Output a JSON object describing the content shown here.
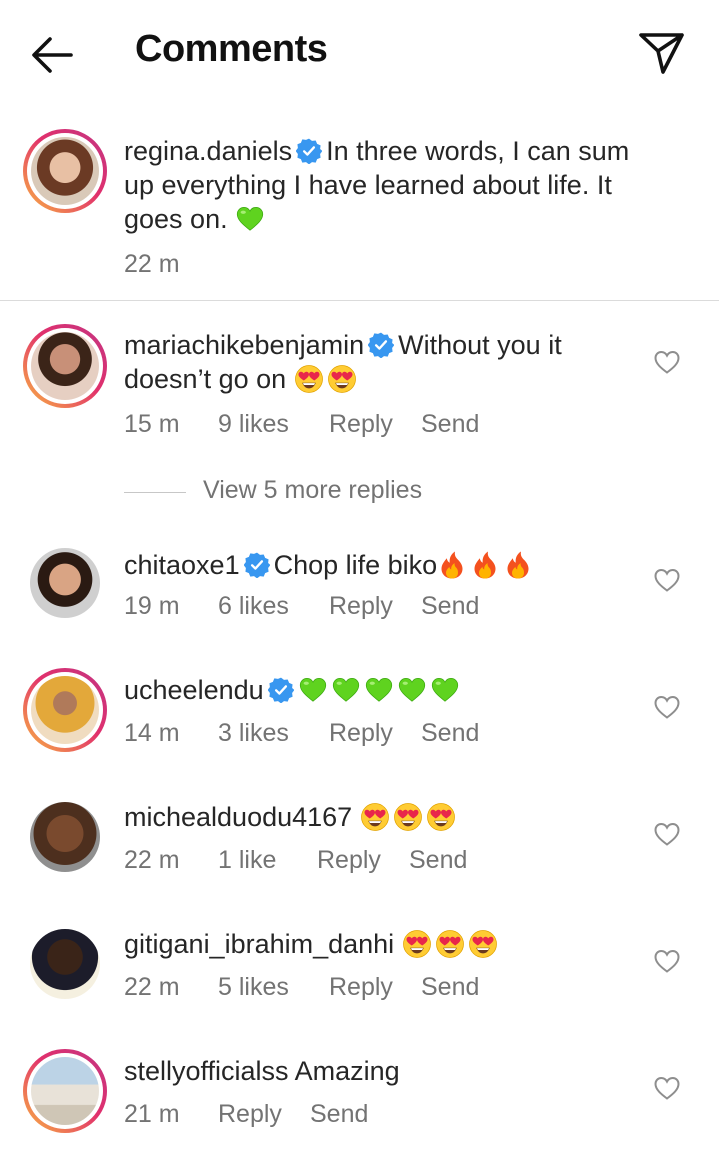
{
  "header": {
    "title": "Comments",
    "back_icon": "arrow-left-icon",
    "send_icon": "paper-plane-icon"
  },
  "caption": {
    "username": "regina.daniels",
    "verified": true,
    "text": "In three words, I can sum up everything I have learned about life. It goes on.",
    "emoji": "green-heart",
    "time": "22 m"
  },
  "comments": [
    {
      "username": "mariachikebenjamin",
      "verified": true,
      "text": "Without you it doesn’t go on",
      "emojis": [
        "heart-eyes",
        "heart-eyes"
      ],
      "time": "15 m",
      "likes": "9 likes",
      "reply": "Reply",
      "send": "Send",
      "view_replies": "View 5 more replies"
    },
    {
      "username": "chitaoxe1",
      "verified": true,
      "text": "Chop life biko",
      "emojis": [
        "fire",
        "fire",
        "fire"
      ],
      "time": "19 m",
      "likes": "6 likes",
      "reply": "Reply",
      "send": "Send"
    },
    {
      "username": "ucheelendu",
      "verified": true,
      "text": "",
      "emojis": [
        "green-heart",
        "green-heart",
        "green-heart",
        "green-heart",
        "green-heart"
      ],
      "time": "14 m",
      "likes": "3 likes",
      "reply": "Reply",
      "send": "Send"
    },
    {
      "username": "michealduodu4167",
      "verified": false,
      "text": "",
      "emojis": [
        "heart-eyes",
        "heart-eyes",
        "heart-eyes"
      ],
      "time": "22 m",
      "likes": "1 like",
      "reply": "Reply",
      "send": "Send"
    },
    {
      "username": "gitigani_ibrahim_danhi",
      "verified": false,
      "text": "",
      "emojis": [
        "heart-eyes",
        "heart-eyes",
        "heart-eyes"
      ],
      "time": "22 m",
      "likes": "5 likes",
      "reply": "Reply",
      "send": "Send"
    },
    {
      "username": "stellyofficialss",
      "verified": false,
      "text": "Amazing",
      "emojis": [],
      "time": "21 m",
      "likes": "",
      "reply": "Reply",
      "send": "Send"
    }
  ],
  "colors": {
    "verified": "#3897f0",
    "story_ring_start": "#f9b642",
    "story_ring_end": "#c13584",
    "meta_text": "#737373"
  }
}
